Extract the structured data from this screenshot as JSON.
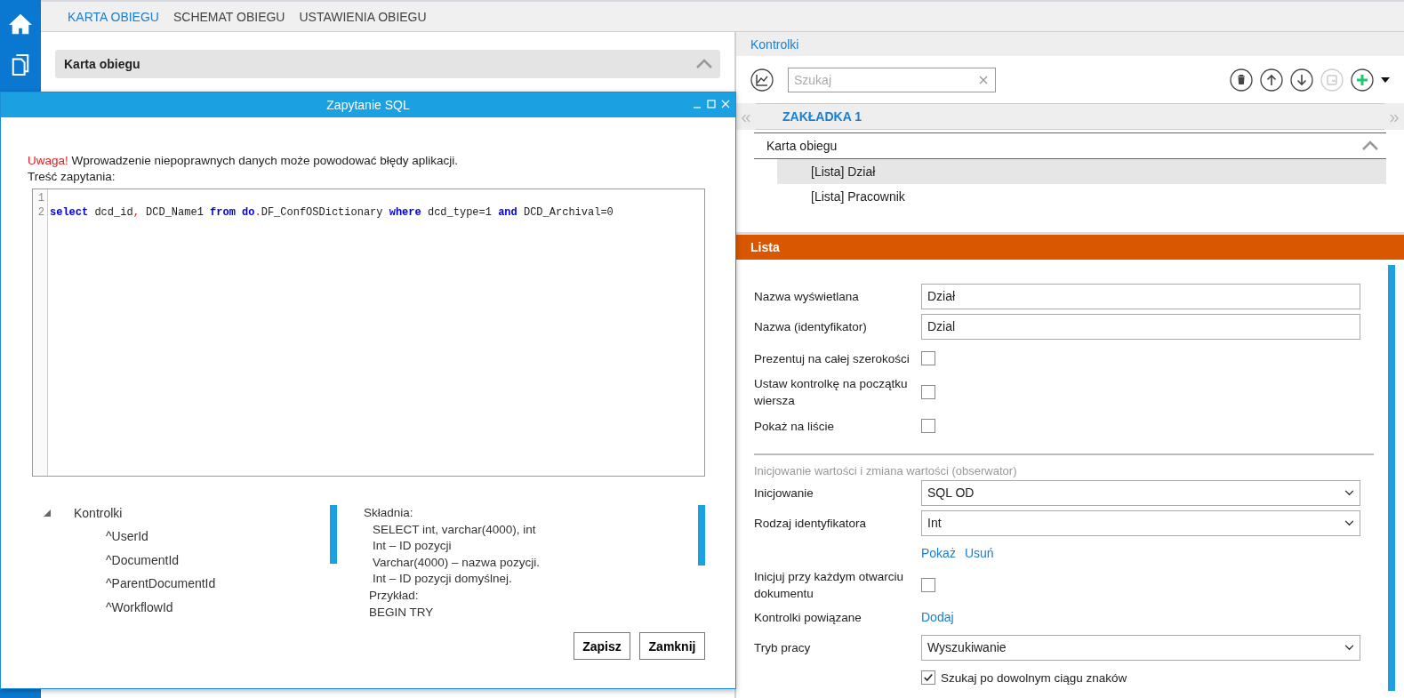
{
  "nav": {
    "tabs": [
      {
        "label": "KARTA OBIEGU",
        "selected": true
      },
      {
        "label": "SCHEMAT OBIEGU",
        "selected": false
      },
      {
        "label": "USTAWIENIA OBIEGU",
        "selected": false
      }
    ]
  },
  "section": {
    "title": "Karta obiegu",
    "expanded": true
  },
  "dialog": {
    "title": "Zapytanie SQL",
    "warning_prefix": "Uwaga!",
    "warning": "Wprowadzenie niepoprawnych danych może powodować błędy aplikacji.",
    "query_label": "Treść zapytania:",
    "code_lines": [
      {
        "number": "1"
      },
      {
        "number": "2",
        "tokens": [
          {
            "kind": "keyword",
            "text": "select"
          },
          {
            "kind": "plain",
            "text": " dcd_id"
          },
          {
            "kind": "operator",
            "text": ","
          },
          {
            "kind": "plain",
            "text": " DCD_Name1 "
          },
          {
            "kind": "keyword",
            "text": "from do"
          },
          {
            "kind": "operator",
            "text": "."
          },
          {
            "kind": "plain",
            "text": "DF_ConfOSDictionary "
          },
          {
            "kind": "keyword",
            "text": "where"
          },
          {
            "kind": "plain",
            "text": " dcd_type=1 "
          },
          {
            "kind": "keyword",
            "text": "and"
          },
          {
            "kind": "plain",
            "text": " DCD_Archival=0"
          }
        ]
      }
    ],
    "tree": {
      "label": "Kontrolki",
      "expanded": true,
      "children": [
        {
          "label": "^UserId"
        },
        {
          "label": "^DocumentId"
        },
        {
          "label": "^ParentDocumentId"
        },
        {
          "label": "^WorkflowId"
        }
      ]
    },
    "syntax_lines": [
      {
        "kind": "title",
        "text": "Składnia:"
      },
      {
        "kind": "item",
        "text": "SELECT int, varchar(4000), int"
      },
      {
        "kind": "item",
        "text": "Int – ID pozycji"
      },
      {
        "kind": "item",
        "text": "Varchar(4000) – nazwa pozycji."
      },
      {
        "kind": "item",
        "text": "Int – ID pozycji domyślnej."
      },
      {
        "kind": "example",
        "text": "Przykład:"
      },
      {
        "kind": "example",
        "text": "BEGIN TRY"
      }
    ],
    "buttons": [
      "Zapisz",
      "Zamknij"
    ]
  },
  "controls": {
    "title": "Kontrolki",
    "search": {
      "placeholder": "Szukaj"
    },
    "toolbar": [
      {
        "kind": "delete",
        "disabled": false
      },
      {
        "kind": "up",
        "disabled": false
      },
      {
        "kind": "down",
        "disabled": false
      },
      {
        "kind": "move",
        "disabled": true
      },
      {
        "kind": "add",
        "disabled": false
      }
    ],
    "tab_prev": "«",
    "tab_next": "»",
    "tabs": [
      {
        "label": "ZAKŁADKA 1",
        "selected": true
      }
    ],
    "group": {
      "label": "Karta obiegu",
      "expanded": true,
      "children": [
        {
          "label": "[Lista] Dział",
          "selected": true
        },
        {
          "label": "[Lista] Pracownik",
          "selected": false
        }
      ]
    }
  },
  "properties": {
    "title": "Lista",
    "rows": [
      {
        "kind": "text",
        "label": "Nazwa wyświetlana",
        "value": "Dział"
      },
      {
        "kind": "text",
        "label": "Nazwa (identyfikator)",
        "value": "Dzial"
      },
      {
        "kind": "checkbox",
        "label": "Prezentuj na całej szerokości",
        "checked": false
      },
      {
        "kind": "checkbox",
        "label": "Ustaw kontrolkę na początku wiersza",
        "checked": false
      },
      {
        "kind": "checkbox",
        "label": "Pokaż na liście",
        "checked": false
      },
      {
        "kind": "section",
        "label": "Inicjowanie wartości i zmiana wartości (obserwator)"
      },
      {
        "kind": "select",
        "label": "Inicjowanie",
        "value": "SQL OD"
      },
      {
        "kind": "select",
        "label": "Rodzaj identyfikatora",
        "value": "Int"
      },
      {
        "kind": "links",
        "links": [
          "Pokaż",
          "Usuń"
        ]
      },
      {
        "kind": "checkbox",
        "label": "Inicjuj przy każdym otwarciu dokumentu",
        "checked": false
      },
      {
        "kind": "links",
        "label": "Kontrolki powiązane",
        "links": [
          "Dodaj"
        ]
      },
      {
        "kind": "select",
        "label": "Tryb pracy",
        "value": "Wyszukiwanie"
      },
      {
        "kind": "inline-checkbox",
        "label": "Szukaj po dowolnym ciągu znaków",
        "checked": true
      }
    ]
  }
}
